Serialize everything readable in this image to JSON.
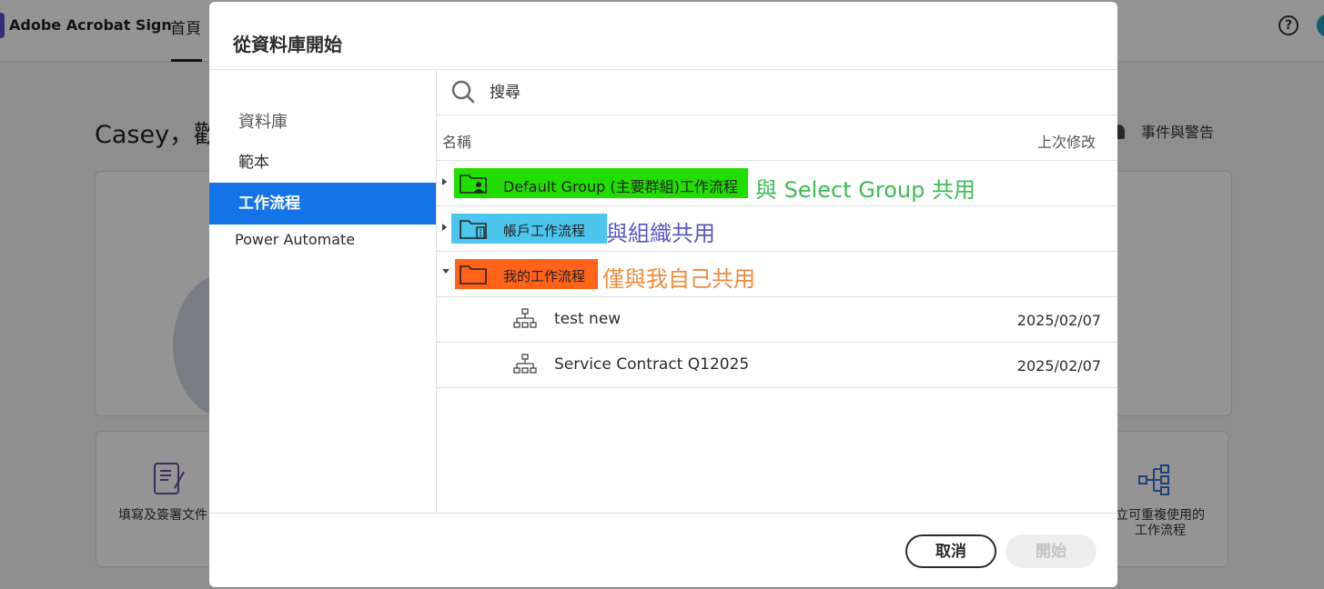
{
  "app": {
    "name": "Adobe Acrobat Sign",
    "nav_home": "首頁",
    "help_glyph": "?",
    "welcome": "Casey，歡",
    "events": "事件與警告",
    "tile_left_label": "填寫及簽署文件",
    "tile_right_label": "立可重複使用的\n工作流程"
  },
  "dialog": {
    "title": "從資料庫開始",
    "sidebar": {
      "header": "資料庫",
      "items": [
        {
          "label": "範本"
        },
        {
          "label": "工作流程"
        },
        {
          "label": "Power Automate"
        }
      ]
    },
    "search": {
      "placeholder": "搜尋"
    },
    "columns": {
      "name": "名稱",
      "modified": "上次修改"
    },
    "folders": [
      {
        "label": "Default Group (主要群組)工作流程",
        "annotation": "與 Select Group 共用",
        "highlight": "#22dd00",
        "annotation_color": "#3dbb55"
      },
      {
        "label": "帳戶工作流程",
        "annotation": "與組織共用",
        "highlight": "#4cc6ec",
        "annotation_color": "#5757c8"
      },
      {
        "label": "我的工作流程",
        "annotation": "僅與我自己共用",
        "highlight": "#ff6319",
        "annotation_color": "#f08a3a"
      }
    ],
    "items": [
      {
        "name": "test new",
        "modified": "2025/02/07"
      },
      {
        "name": "Service Contract Q12025",
        "modified": "2025/02/07"
      }
    ],
    "buttons": {
      "cancel": "取消",
      "start": "開始"
    }
  }
}
